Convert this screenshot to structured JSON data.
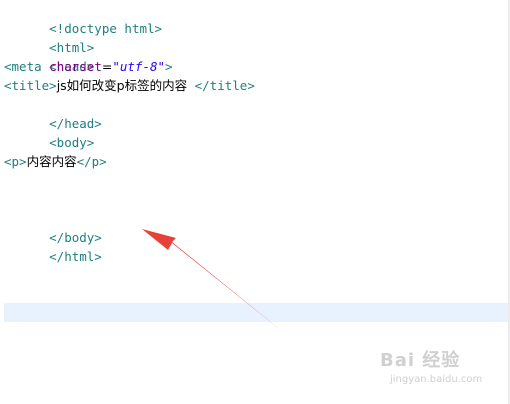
{
  "code": {
    "doctype": "<!doctype html>",
    "html_open": "<html>",
    "head_open": "<head>",
    "meta_open": "<meta",
    "meta_attr": " charset",
    "meta_eq": "=",
    "meta_val": "\"utf-8\"",
    "meta_close": ">",
    "title_open": "<title>",
    "title_text": "js如何改变p标签的内容",
    "title_close": " </title>",
    "head_close": "</head>",
    "body_open": "<body>",
    "p_open": "<p>",
    "p_text": "内容内容",
    "p_close": "</p>",
    "body_close": "</body>",
    "html_close": "</html>"
  },
  "annotation": {
    "arrow_color": "#e8413a"
  },
  "watermark": {
    "brand": "Bai 经验",
    "url": "jingyan.baidu.com"
  },
  "colors": {
    "tag": "#1f7f7f",
    "attribute": "#7f007f",
    "string": "#2a00ff",
    "current_line": "#e8f2fe"
  }
}
